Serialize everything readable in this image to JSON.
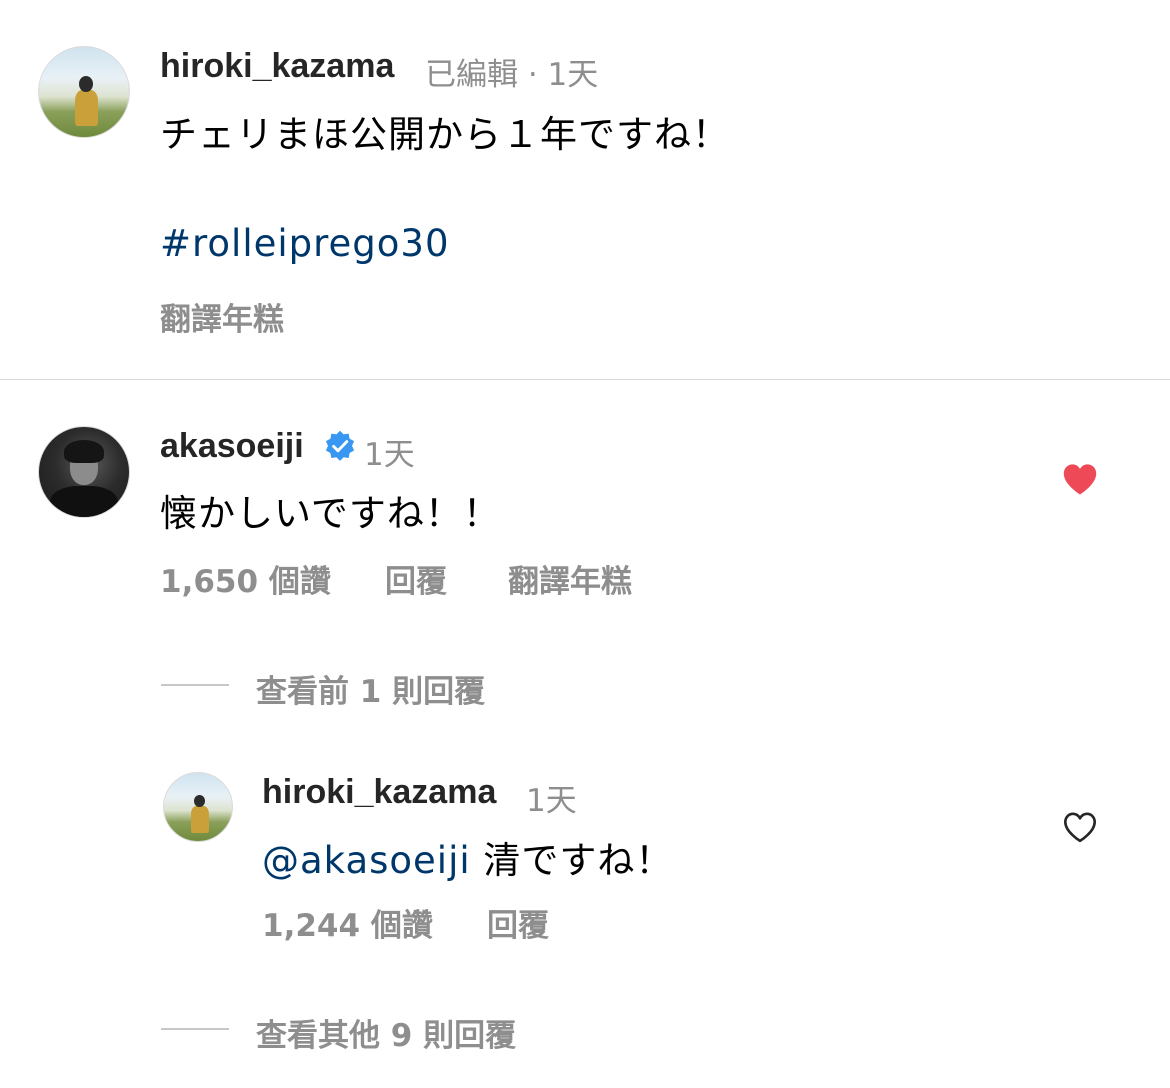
{
  "comments": {
    "first": {
      "username": "hiroki_kazama",
      "meta": "已編輯 · 1天",
      "text": "チェリまほ公開から１年ですね！",
      "hashtag": "#rolleiprego30",
      "translate_label": "翻譯年糕"
    },
    "second": {
      "username": "akasoeiji",
      "verified": true,
      "time": "1天",
      "text": "懐かしいですね！！",
      "likes": "1,650 個讚",
      "reply_label": "回覆",
      "translate_label": "翻譯年糕",
      "liked": true,
      "heart_color": "#ed4956",
      "view_previous_replies": "查看前 1 則回覆"
    },
    "reply": {
      "username": "hiroki_kazama",
      "time": "1天",
      "mention": "@akasoeiji",
      "text": "清ですね！",
      "likes": "1,244 個讚",
      "reply_label": "回覆",
      "liked": false
    },
    "view_more_replies": "查看其他 9 則回覆"
  },
  "colors": {
    "link": "#00376b",
    "meta": "#8e8e8e",
    "verified": "#3897f0",
    "liked_heart": "#ed4956"
  },
  "icons": {
    "verified": "verified-badge-icon",
    "heart_filled": "heart-filled-icon",
    "heart_outline": "heart-outline-icon"
  }
}
